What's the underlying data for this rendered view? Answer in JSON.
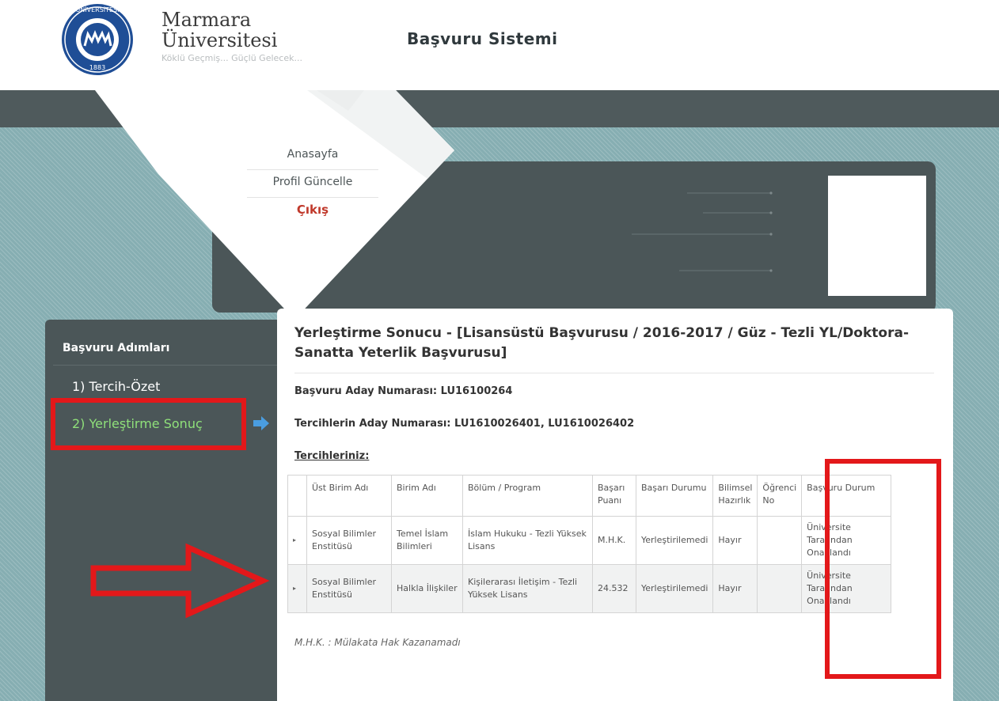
{
  "header": {
    "university_line1": "Marmara",
    "university_line2": "Üniversitesi",
    "slogan": "Köklü Geçmiş... Güçlü Gelecek...",
    "system_title": "Başvuru Sistemi",
    "seal_text": "MARMARA ÜNİVERSİTESİ",
    "seal_year": "1883"
  },
  "nav": {
    "home": "Anasayfa",
    "profile": "Profil Güncelle",
    "logout": "Çıkış"
  },
  "sidebar": {
    "title": "Başvuru Adımları",
    "items": [
      {
        "label": "1) Tercih-Özet"
      },
      {
        "label": "2) Yerleştirme Sonuç"
      }
    ]
  },
  "main": {
    "title": "Yerleştirme Sonucu - [Lisansüstü Başvurusu / 2016-2017 / Güz - Tezli YL/Doktora-Sanatta Yeterlik Başvurusu]",
    "applicant_number": "Başvuru Aday Numarası: LU16100264",
    "preference_numbers": "Tercihlerin Aday Numarası: LU1610026401, LU1610026402",
    "preferences_label": "Tercihleriniz:",
    "table": {
      "headers": [
        "",
        "Üst Birim Adı",
        "Birim Adı",
        "Bölüm / Program",
        "Başarı Puanı",
        "Başarı Durumu",
        "Bilimsel Hazırlık",
        "Öğrenci No",
        "Başvuru Durum"
      ],
      "rows": [
        [
          "▸",
          "Sosyal Bilimler Enstitüsü",
          "Temel İslam Bilimleri",
          "İslam Hukuku - Tezli Yüksek Lisans",
          "M.H.K.",
          "Yerleştirilemedi",
          "Hayır",
          "",
          "Üniversite Tarafından Onaylandı"
        ],
        [
          "▸",
          "Sosyal Bilimler Enstitüsü",
          "Halkla İlişkiler",
          "Kişilerarası İletişim - Tezli Yüksek Lisans",
          "24.532",
          "Yerleştirilemedi",
          "Hayır",
          "",
          "Üniversite Tarafından Onaylandı"
        ]
      ]
    },
    "footnote": "M.H.K. : Mülakata Hak Kazanamadı"
  },
  "colors": {
    "topbar": "#4f5a5c",
    "panel": "#4b5658",
    "background": "#86aeb2",
    "active_step": "#8fe07a",
    "logout": "#c0392b",
    "highlight": "#e3181a"
  },
  "icons": [
    "marmara-seal-logo",
    "arrow-right-icon",
    "expand-row-icon"
  ]
}
